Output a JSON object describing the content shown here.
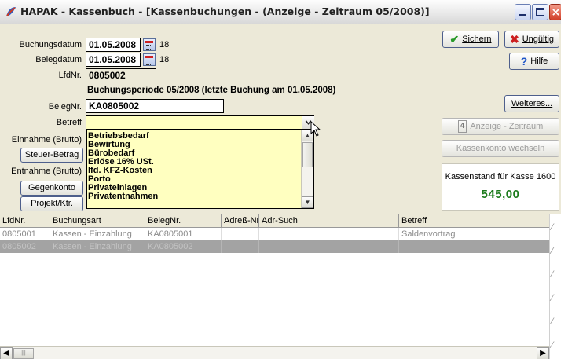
{
  "window": {
    "title": "HAPAK - Kassenbuch - [Kassenbuchungen - (Anzeige - Zeitraum 05/2008)]",
    "icon": "hapak-app-icon"
  },
  "form": {
    "buchungsdatum_label": "Buchungsdatum",
    "buchungsdatum_value": "01.05.2008",
    "buchungsdatum_num": "18",
    "belegdatum_label": "Belegdatum",
    "belegdatum_value": "01.05.2008",
    "belegdatum_num": "18",
    "lfdnr_label": "LfdNr.",
    "lfdnr_value": "0805002",
    "period_text": "Buchungsperiode 05/2008 (letzte Buchung am 01.05.2008)",
    "belegnr_label": "BelegNr.",
    "belegnr_value": "KA0805002",
    "betreff_label": "Betreff",
    "betreff_value": "",
    "einnahme_label": "Einnahme (Brutto)",
    "steuer_button": "Steuer-Betrag",
    "entnahme_label": "Entnahme (Brutto)",
    "gegenkonto_button": "Gegenkonto",
    "projekt_button": "Projekt/Ktr."
  },
  "betreff_options": [
    "Betriebsbedarf",
    "Bewirtung",
    "Bürobedarf",
    "Erlöse 16% USt.",
    "lfd. KFZ-Kosten",
    "Porto",
    "Privateinlagen",
    "Privatentnahmen"
  ],
  "buttons": {
    "sichern": "Sichern",
    "ungueltig": "Ungültig",
    "hilfe": "Hilfe",
    "weiteres": "Weiteres...",
    "anzeige_zeitraum": "Anzeige - Zeitraum",
    "kassenkonto": "Kassenkonto wechseln"
  },
  "kassenstand": {
    "label": "Kassenstand für Kasse 1600",
    "value": "545,00"
  },
  "table": {
    "columns": [
      "LfdNr.",
      "Buchungsart",
      "BelegNr.",
      "Adreß-Nr.",
      "Adr-Such",
      "Betreff"
    ],
    "rows": [
      [
        "0805001",
        "Kassen - Einzahlung",
        "KA0805001",
        "",
        "",
        "Saldenvortrag"
      ],
      [
        "0805002",
        "Kassen - Einzahlung",
        "KA0805002",
        "",
        "",
        ""
      ]
    ]
  },
  "colors": {
    "accent_green": "#1b7a1b",
    "dropdown_bg": "#ffffc0",
    "selected_row": "#a3a3a3"
  }
}
